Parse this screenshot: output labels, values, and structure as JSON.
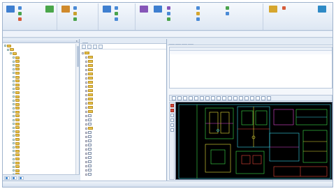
{
  "ribbon": {
    "big_buttons": [
      {
        "label": "",
        "color": "#3e7fd0"
      },
      {
        "label": "",
        "color": "#4aa64a"
      },
      {
        "label": "",
        "color": "#d08a2c"
      },
      {
        "label": "",
        "color": "#3e7fd0"
      },
      {
        "label": "",
        "color": "#8656b8"
      },
      {
        "label": "",
        "color": "#3e7fd0"
      },
      {
        "label": "",
        "color": "#d6a62e"
      },
      {
        "label": "",
        "color": "#2f8ac6"
      }
    ],
    "small_buttons": [
      {
        "label": "",
        "color": "#4a8ad6"
      },
      {
        "label": "",
        "color": "#49a34c"
      },
      {
        "label": "",
        "color": "#d65c3a"
      },
      {
        "label": "",
        "color": "#4a8ad6"
      },
      {
        "label": "",
        "color": "#c9a12e"
      },
      {
        "label": "",
        "color": "#49a34c"
      },
      {
        "label": "",
        "color": "#4a8ad6"
      },
      {
        "label": "",
        "color": "#49a34c"
      },
      {
        "label": "",
        "color": "#4a8ad6"
      },
      {
        "label": "",
        "color": "#8656b8"
      },
      {
        "label": "",
        "color": "#4a8ad6"
      },
      {
        "label": "",
        "color": "#49a34c"
      },
      {
        "label": "",
        "color": "#4a8ad6"
      },
      {
        "label": "",
        "color": "#d6a62e"
      },
      {
        "label": "",
        "color": "#4a8ad6"
      },
      {
        "label": "",
        "color": "#49a34c"
      },
      {
        "label": "",
        "color": "#4a8ad6"
      },
      {
        "label": "",
        "color": "#d65c3a"
      }
    ],
    "group_labels": [
      "",
      "",
      "",
      "",
      ""
    ]
  },
  "menubar": {
    "items": [
      "",
      "",
      "",
      ""
    ]
  },
  "left_pane": {
    "title": "",
    "tree": [
      {
        "level": 0,
        "label": ""
      },
      {
        "level": 1,
        "label": ""
      },
      {
        "level": 2,
        "label": ""
      },
      {
        "level": 3,
        "label": ""
      },
      {
        "level": 3,
        "label": ""
      },
      {
        "level": 3,
        "label": ""
      },
      {
        "level": 3,
        "label": ""
      },
      {
        "level": 3,
        "label": ""
      },
      {
        "level": 3,
        "label": ""
      },
      {
        "level": 3,
        "label": ""
      },
      {
        "level": 3,
        "label": ""
      },
      {
        "level": 3,
        "label": ""
      },
      {
        "level": 3,
        "label": ""
      },
      {
        "level": 3,
        "label": ""
      },
      {
        "level": 3,
        "label": ""
      },
      {
        "level": 3,
        "label": ""
      },
      {
        "level": 3,
        "label": ""
      },
      {
        "level": 3,
        "label": ""
      },
      {
        "level": 3,
        "label": ""
      },
      {
        "level": 3,
        "label": ""
      },
      {
        "level": 3,
        "label": ""
      },
      {
        "level": 3,
        "label": ""
      },
      {
        "level": 3,
        "label": ""
      },
      {
        "level": 3,
        "label": ""
      },
      {
        "level": 3,
        "label": ""
      },
      {
        "level": 3,
        "label": ""
      },
      {
        "level": 3,
        "label": ""
      },
      {
        "level": 3,
        "label": ""
      },
      {
        "level": 3,
        "label": ""
      },
      {
        "level": 3,
        "label": ""
      },
      {
        "level": 3,
        "label": ""
      },
      {
        "level": 3,
        "label": ""
      },
      {
        "level": 3,
        "label": ""
      },
      {
        "level": 3,
        "label": ""
      }
    ],
    "footer_tabs": [
      "",
      "",
      ""
    ]
  },
  "mid_pane": {
    "tab": "",
    "toolbar_text": "",
    "tree": [
      {
        "level": 0,
        "icon": "folder",
        "label": ""
      },
      {
        "level": 1,
        "icon": "folder",
        "label": ""
      },
      {
        "level": 1,
        "icon": "folder",
        "label": ""
      },
      {
        "level": 1,
        "icon": "folder",
        "label": ""
      },
      {
        "level": 1,
        "icon": "folder",
        "label": ""
      },
      {
        "level": 1,
        "icon": "folder",
        "label": ""
      },
      {
        "level": 1,
        "icon": "folder",
        "label": ""
      },
      {
        "level": 1,
        "icon": "folder",
        "label": ""
      },
      {
        "level": 1,
        "icon": "folder",
        "label": ""
      },
      {
        "level": 1,
        "icon": "folder",
        "label": ""
      },
      {
        "level": 1,
        "icon": "folder",
        "label": ""
      },
      {
        "level": 1,
        "icon": "folder",
        "label": ""
      },
      {
        "level": 1,
        "icon": "folder",
        "label": ""
      },
      {
        "level": 1,
        "icon": "folder",
        "label": ""
      },
      {
        "level": 1,
        "icon": "folder",
        "label": ""
      },
      {
        "level": 1,
        "icon": "doc",
        "label": ""
      },
      {
        "level": 1,
        "icon": "doc",
        "label": ""
      },
      {
        "level": 1,
        "icon": "doc",
        "label": ""
      },
      {
        "level": 1,
        "icon": "folder",
        "label": ""
      },
      {
        "level": 1,
        "icon": "doc",
        "label": ""
      },
      {
        "level": 1,
        "icon": "doc",
        "label": ""
      },
      {
        "level": 1,
        "icon": "doc",
        "label": ""
      },
      {
        "level": 1,
        "icon": "doc",
        "label": ""
      },
      {
        "level": 1,
        "icon": "doc",
        "label": ""
      },
      {
        "level": 1,
        "icon": "doc",
        "label": ""
      },
      {
        "level": 1,
        "icon": "doc",
        "label": ""
      },
      {
        "level": 1,
        "icon": "doc",
        "label": ""
      },
      {
        "level": 1,
        "icon": "doc",
        "label": ""
      },
      {
        "level": 1,
        "icon": "doc",
        "label": ""
      },
      {
        "level": 1,
        "icon": "doc",
        "label": ""
      }
    ]
  },
  "right_pane": {
    "tabs": [
      "",
      "",
      "",
      ""
    ],
    "active_tab": 1,
    "table_headers": [
      "",
      "",
      "",
      ""
    ],
    "table_rows": [
      [
        "",
        "",
        "",
        ""
      ]
    ]
  },
  "statusbar": {
    "items": [
      "",
      ""
    ]
  },
  "colors": {
    "cad_background": "#000000",
    "cad_line_green": "#3fe04a",
    "cad_line_cyan": "#3ad6e8",
    "cad_line_yellow": "#e8e03a",
    "cad_line_magenta": "#e24ad6",
    "cad_line_red": "#e84a3a"
  }
}
